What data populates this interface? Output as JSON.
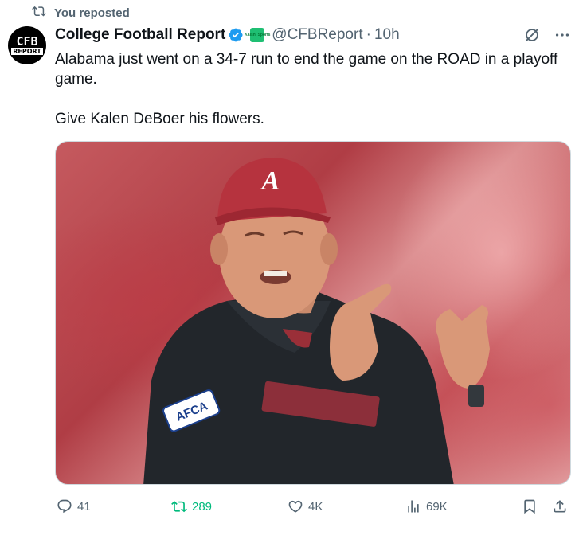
{
  "repost": {
    "label": "You reposted"
  },
  "author": {
    "avatar_text_top": "CFB",
    "avatar_text_bottom": "REPORT",
    "name": "College Football Report",
    "affiliate_text": "Kalshi Sports",
    "handle": "@CFBReport",
    "separator": "·",
    "time": "10h"
  },
  "tweet": {
    "paragraph1": "Alabama just went on a 34-7 run to end the game on the ROAD in a playoff game.",
    "paragraph2": "Give Kalen DeBoer his flowers."
  },
  "media": {
    "cap_logo": "A",
    "patch_text": "AFCA"
  },
  "actions": {
    "replies": "41",
    "reposts": "289",
    "likes": "4K",
    "views": "69K"
  },
  "colors": {
    "accent": "#1d9bf0",
    "repost_green": "#00ba7c",
    "muted": "#536471"
  },
  "icons": {
    "repost": "repost-icon",
    "verified": "verified-badge-icon",
    "grok": "grok-icon",
    "more": "more-icon",
    "reply": "reply-icon",
    "like": "heart-icon",
    "views": "views-icon",
    "bookmark": "bookmark-icon",
    "share": "share-icon"
  }
}
